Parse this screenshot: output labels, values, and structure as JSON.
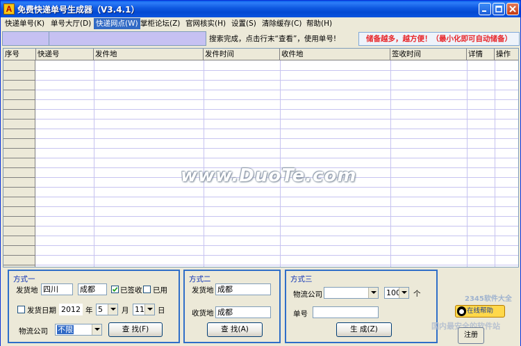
{
  "window": {
    "title": "免费快递单号生成器（V3.4.1）"
  },
  "menu": [
    {
      "label": "快递单号(K)",
      "active": false
    },
    {
      "label": "单号大厅(D)",
      "active": false
    },
    {
      "label": "快递网点(W)",
      "active": true
    },
    {
      "label": "掌柜论坛(Z)",
      "active": false
    },
    {
      "label": "官网核实(H)",
      "active": false
    },
    {
      "label": "设置(S)",
      "active": false
    },
    {
      "label": "清除缓存(C)",
      "active": false
    },
    {
      "label": "帮助(H)",
      "active": false
    }
  ],
  "status": {
    "message": "搜索完成，点击行末“查看”，使用单号!",
    "tip": "储备越多，越方便！（最小化即可自动储备）"
  },
  "table": {
    "columns": [
      "序号",
      "快递号",
      "发件地",
      "发件时间",
      "收件地",
      "签收时间",
      "详情",
      "操作"
    ]
  },
  "watermark": "www.DuoTe.com",
  "mode1": {
    "title": "方式一",
    "origin_label": "发货地",
    "province": "四川",
    "city": "成都",
    "signed_label": "已签收",
    "signed_checked": true,
    "used_label": "已用",
    "used_checked": false,
    "date_label": "发货日期",
    "date_checked": false,
    "year": "2012",
    "year_unit": "年",
    "month": "5",
    "month_unit": "月",
    "day": "11",
    "day_unit": "日",
    "company_label": "物流公司",
    "company_value": "不限",
    "search_button": "查 找(F)"
  },
  "mode2": {
    "title": "方式二",
    "origin_label": "发货地",
    "origin_value": "成都",
    "dest_label": "收货地",
    "dest_value": "成都",
    "search_button": "查 找(A)"
  },
  "mode3": {
    "title": "方式三",
    "company_label": "物流公司",
    "company_value": "",
    "count_value": "100",
    "count_unit": "个",
    "number_label": "单号",
    "number_value": "",
    "generate_button": "生 成(Z)"
  },
  "help": {
    "online_help": "在线帮助",
    "register_button": "注册",
    "watermark_text": "国内最安全的软件站",
    "brand_text": "2345软件大全"
  }
}
